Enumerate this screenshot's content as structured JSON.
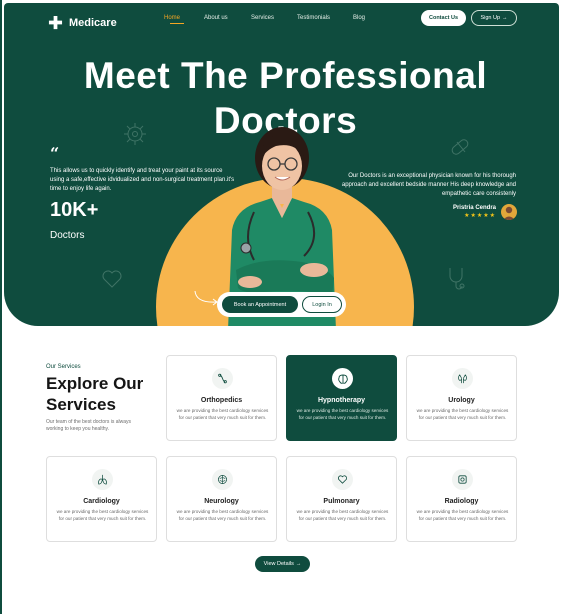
{
  "brand": {
    "name": "Medicare",
    "primary": "#0f4c3e",
    "accent": "#f5a623",
    "sun": "#f7b54d"
  },
  "nav": {
    "items": [
      "Home",
      "About us",
      "Services",
      "Testimonials",
      "Blog"
    ],
    "active": "Home"
  },
  "header_actions": {
    "contact": "Contact Us",
    "signup": "Sign Up",
    "signup_icon": "arrow-right-icon"
  },
  "hero": {
    "title_line1": "Meet The Professional",
    "title_line2": "Doctors",
    "quote_mark": "“",
    "description": "This allows us to quickly identify and treat your paint at its source using a safe,effective idvidualized and non-surgical treatment plan.it's time to enjoy life again.",
    "stat_value": "10K+",
    "stat_label": "Doctors",
    "right_description": "Our Doctors is an exceptional physician known for his thorough approach and excellent bedside manner His deep knowledge and empathetic care consistenly",
    "reviewer_name": "Pristria Cendra",
    "rating": "★★★★★",
    "book_button": "Book an Appointment",
    "login_button": "Login In"
  },
  "services": {
    "eyebrow": "Our Services",
    "heading": "Explore Our Services",
    "subtext": "Our team of the best doctors is always working to keep you  healthy.",
    "cards": [
      {
        "title": "Orthopedics",
        "desc": "we are providing the best cardiology services for our patient that very much suit for them.",
        "icon": "bone-icon",
        "active": false
      },
      {
        "title": "Hypnotherapy",
        "desc": "we are providing the best cardiology services for our patient that very much suit for them.",
        "icon": "brain-icon",
        "active": true
      },
      {
        "title": "Urology",
        "desc": "we are providing the best cardiology services for our patient that very much suit for them.",
        "icon": "kidney-icon",
        "active": false
      },
      {
        "title": "Cardiology",
        "desc": "we are providing the best cardiology services for our patient that very much suit for them.",
        "icon": "lungs-icon",
        "active": false
      },
      {
        "title": "Neurology",
        "desc": "we are providing the best cardiology services for our patient that very much suit for them.",
        "icon": "neuron-icon",
        "active": false
      },
      {
        "title": "Pulmonary",
        "desc": "we are providing the best cardiology services for our patient that very much suit for them.",
        "icon": "heart-icon",
        "active": false
      },
      {
        "title": "Radiology",
        "desc": "we are providing the best cardiology services for our patient that very much suit for them.",
        "icon": "scan-icon",
        "active": false
      }
    ],
    "view_details": "View Details",
    "view_icon": "arrow-right-icon"
  }
}
